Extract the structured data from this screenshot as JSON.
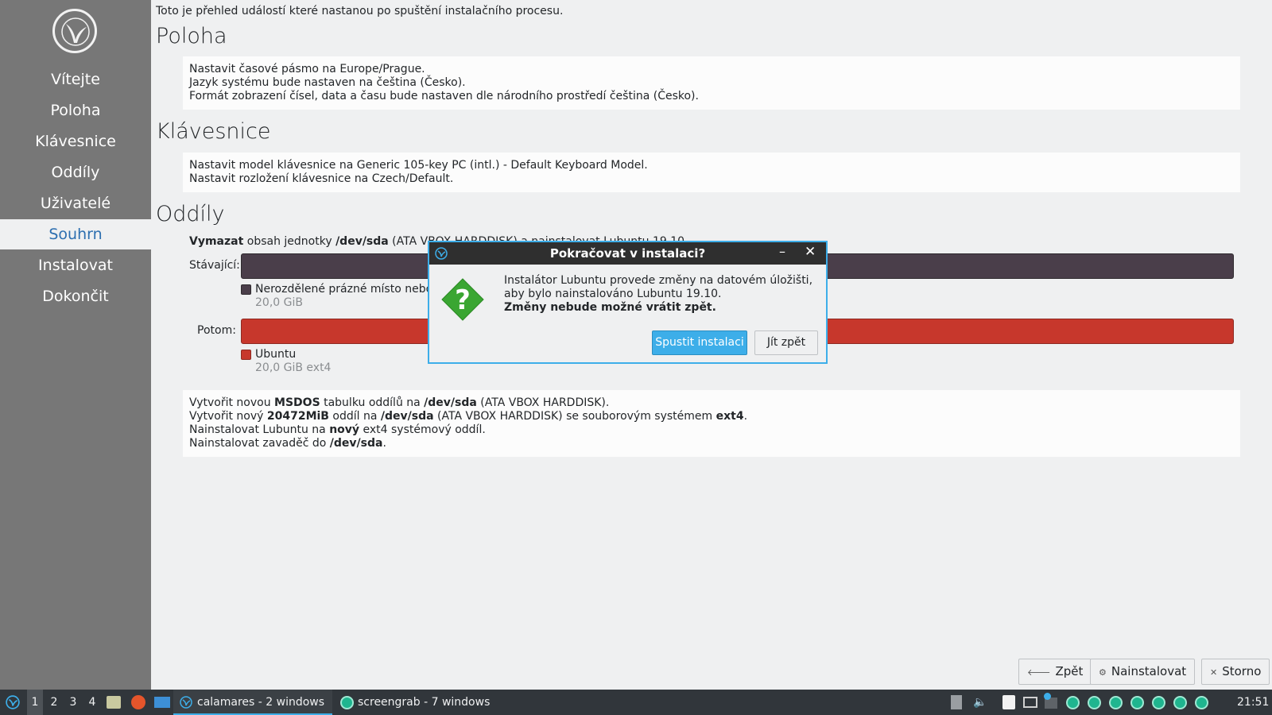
{
  "sidebar": {
    "items": [
      {
        "label": "Vítejte"
      },
      {
        "label": "Poloha"
      },
      {
        "label": "Klávesnice"
      },
      {
        "label": "Oddíly"
      },
      {
        "label": "Uživatelé"
      },
      {
        "label": "Souhrn",
        "active": true
      },
      {
        "label": "Instalovat"
      },
      {
        "label": "Dokončit"
      }
    ]
  },
  "main": {
    "intro": "Toto je přehled událostí které nastanou po spuštění instalačního procesu.",
    "location": {
      "title": "Poloha",
      "lines": [
        "Nastavit časové pásmo na Europe/Prague.",
        "Jazyk systému bude nastaven na čeština (Česko).",
        "Formát zobrazení čísel, data a času bude nastaven dle národního prostředí čeština (Česko)."
      ]
    },
    "keyboard": {
      "title": "Klávesnice",
      "lines": [
        "Nastavit model klávesnice na Generic 105-key PC (intl.) - Default Keyboard Model.",
        "Nastavit rozložení klávesnice na Czech/Default."
      ]
    },
    "partitions": {
      "title": "Oddíly",
      "head_bold1": "Vymazat",
      "head_text1": " obsah jednotky ",
      "head_bold2": "/dev/sda",
      "head_text2": " (ATA VBOX HARDDISK) a nainstalovat Lubuntu 19.10.",
      "current_label": "Stávající:",
      "after_label": "Potom:",
      "current_legend": {
        "name": "Nerozdělené prázné místo nebo neznámá tabulka oddílů",
        "size": "20,0 GiB",
        "color": "#4a3e4a"
      },
      "after_legend": {
        "name": "Ubuntu",
        "size": "20,0 GiB ext4",
        "color": "#c7372c"
      },
      "ops": {
        "l1_a": "Vytvořit novou ",
        "l1_b": "MSDOS",
        "l1_c": " tabulku oddílů na ",
        "l1_d": "/dev/sda",
        "l1_e": " (ATA VBOX HARDDISK).",
        "l2_a": "Vytvořit nový ",
        "l2_b": "20472MiB",
        "l2_c": " oddíl na ",
        "l2_d": "/dev/sda",
        "l2_e": " (ATA VBOX HARDDISK) se souborovým systémem ",
        "l2_f": "ext4",
        "l2_g": ".",
        "l3_a": "Nainstalovat Lubuntu na ",
        "l3_b": "nový",
        "l3_c": " ext4 systémový oddíl.",
        "l4_a": "Nainstalovat zavaděč do ",
        "l4_b": "/dev/sda",
        "l4_c": "."
      }
    }
  },
  "buttons": {
    "back": "Zpět",
    "install": "Nainstalovat",
    "cancel": "Storno"
  },
  "dialog": {
    "title": "Pokračovat v instalaci?",
    "line1": "Instalátor Lubuntu provede změny na datovém úložišti,",
    "line2": "aby bylo nainstalováno Lubuntu 19.10.",
    "line3": "Změny nebude možné vrátit zpět.",
    "ok": "Spustit instalaci",
    "back": "Jít zpět",
    "minimize": "–",
    "close": "✕"
  },
  "taskbar": {
    "workspaces": [
      "1",
      "2",
      "3",
      "4"
    ],
    "task1": "calamares - 2 windows",
    "task2": "screengrab - 7 windows",
    "clock": "21:51"
  },
  "colors": {
    "accent": "#3daee9",
    "sidebar": "#777777",
    "active_text": "#2d6fb0",
    "taskbar": "#31363b"
  }
}
